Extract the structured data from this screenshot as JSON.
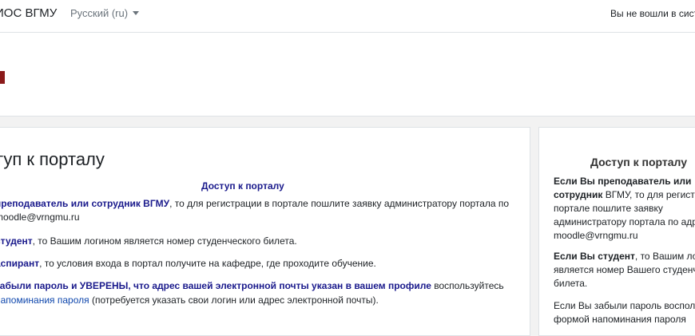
{
  "navbar": {
    "brand": "ИОС ВГМУ",
    "language": "Русский (ru)",
    "login_status": "Вы не вошли в систе"
  },
  "main": {
    "title": "туп к порталу",
    "heading": "Доступ к порталу",
    "p1_bold": "преподаватель или сотрудник ВГМУ",
    "p1_rest": ", то для регистрации в портале пошлите заявку администратору портала по",
    "p1_email": "moodle@vrngmu.ru",
    "p2_bold": "студент",
    "p2_rest": ", то Вашим логином является номер студенческого билета.",
    "p3_bold": "аспирант",
    "p3_rest": ", то условия входа в портал получите на кафедре, где проходите обучение.",
    "p4_bold": "забыли пароль и УВЕРЕНЫ, что адрес вашей электронной почты указан в вашем профиле",
    "p4_rest": " воспользуйтесь",
    "p5_link": "напоминания пароля",
    "p5_rest": " (потребуется указать свои логин или адрес электронной почты)."
  },
  "sidebar": {
    "title": "Доступ к порталу",
    "s1_bold_line1": "Если Вы преподаватель или",
    "s1_bold_line2": "сотрудник",
    "s1_rest_line2": " ВГМУ, то для регистр",
    "s1_line3": "портале пошлите заявку",
    "s1_line4": "администратору портала по адре",
    "s1_line5": "moodle@vrngmu.ru",
    "s2_bold": "Если Вы студент",
    "s2_rest_line1": ", то Вашим логи",
    "s2_line2": "является номер Вашего студенч",
    "s2_line3": "билета.",
    "s3_line1": "Если Вы забыли пароль воспольз",
    "s3_line2": "формой напоминания пароля"
  }
}
